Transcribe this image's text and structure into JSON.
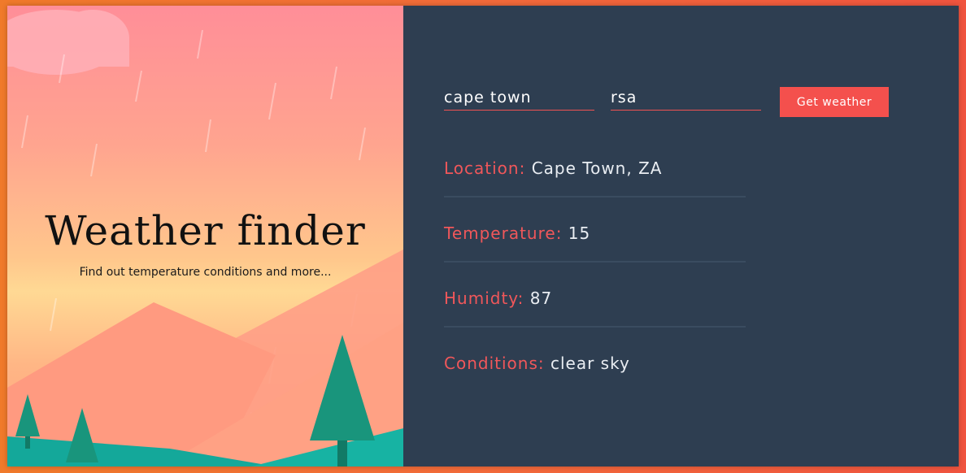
{
  "hero": {
    "title": "Weather finder",
    "subtitle": "Find out temperature conditions and more..."
  },
  "form": {
    "city_value": "cape town",
    "country_value": "rsa",
    "submit_label": "Get weather"
  },
  "results": [
    {
      "label": "Location:",
      "value": "Cape Town, ZA"
    },
    {
      "label": "Temperature:",
      "value": "15"
    },
    {
      "label": "Humidty:",
      "value": "87"
    },
    {
      "label": "Conditions:",
      "value": "clear sky"
    }
  ],
  "colors": {
    "accent": "#f4504d",
    "panel": "#2e3e51",
    "background": "#f26a3a"
  },
  "icons": [
    "cloud-icon",
    "tree-icon",
    "mountain-icon",
    "rain-icon"
  ]
}
